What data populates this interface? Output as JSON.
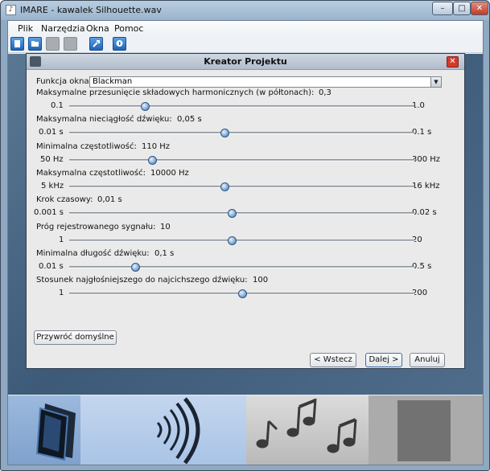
{
  "window": {
    "title": "IMARE - kawalek Silhouette.wav",
    "app_icon": "music-note-icon",
    "controls": {
      "minimize": "–",
      "maximize": "□",
      "close": "✕"
    }
  },
  "menu": [
    "Plik",
    "Narzędzia",
    "Okna",
    "Pomoc"
  ],
  "toolbar": [
    "new-document-icon",
    "open-folder-icon",
    "save-icon-disabled",
    "save-as-icon-disabled",
    "settings-wrench-icon",
    "help-icon"
  ],
  "dialog": {
    "title": "Kreator Projektu",
    "close": "✕",
    "window_function_label": "Funkcja okna:",
    "window_function_value": "Blackman",
    "sliders": [
      {
        "label": "Maksymalne przesunięcie składowych harmonicznych (w półtonach):",
        "value": "0,3",
        "min": "0.1",
        "max": "1.0",
        "level": 0.22
      },
      {
        "label": "Maksymalna nieciągłość dźwięku:",
        "value": "0,05 s",
        "min": "0.01 s",
        "max": "0.1 s",
        "level": 0.45
      },
      {
        "label": "Minimalna częstotliwość:",
        "value": "110 Hz",
        "min": "50 Hz",
        "max": "300 Hz",
        "level": 0.24
      },
      {
        "label": "Maksymalna częstotliwość:",
        "value": "10000 Hz",
        "min": "5 kHz",
        "max": "16 kHz",
        "level": 0.45
      },
      {
        "label": "Krok czasowy:",
        "value": "0,01 s",
        "min": "0.001 s",
        "max": "0.02 s",
        "level": 0.47
      },
      {
        "label": "Próg rejestrowanego sygnału:",
        "value": "10",
        "min": "1",
        "max": "20",
        "level": 0.47
      },
      {
        "label": "Minimalna długość dźwięku:",
        "value": "0,1 s",
        "min": "0.01 s",
        "max": "0.5 s",
        "level": 0.19
      },
      {
        "label": "Stosunek najgłośniejszego do najcichszego dźwięku:",
        "value": "100",
        "min": "1",
        "max": "200",
        "level": 0.5
      }
    ],
    "reset_button": "Przywróć domyślne",
    "back_button": "< Wstecz",
    "next_button": "Dalej >",
    "cancel_button": "Anuluj"
  },
  "colors": {
    "accent": "#1f63b5",
    "close": "#d23a2a",
    "workspace": "#4a6888"
  }
}
